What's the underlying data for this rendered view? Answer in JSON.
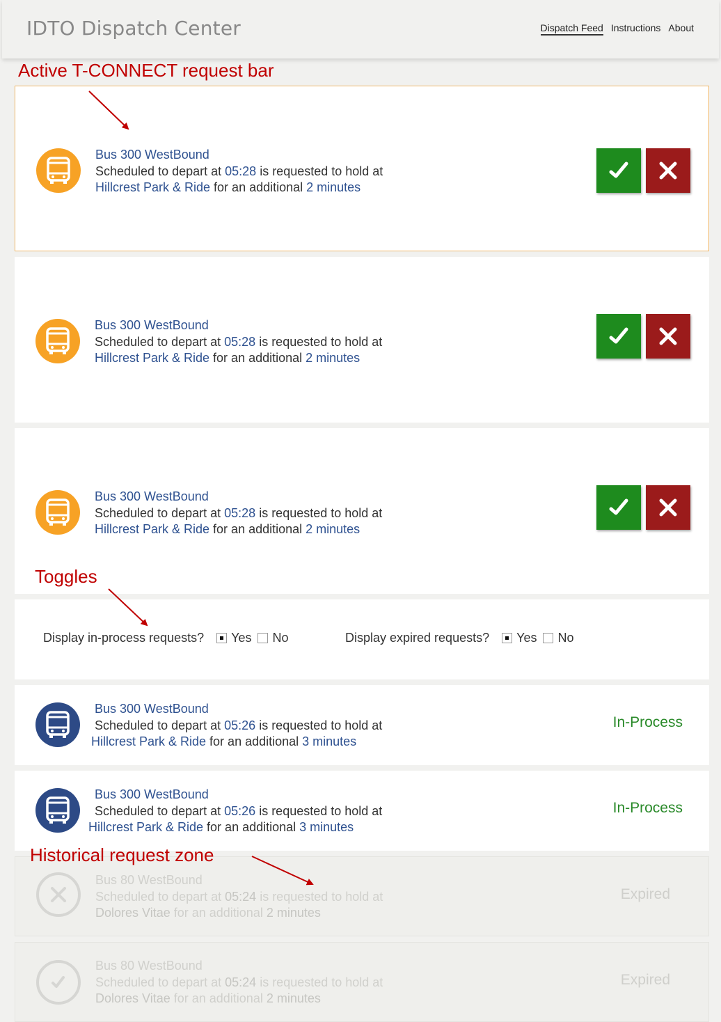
{
  "header": {
    "title": "IDTO Dispatch Center",
    "nav": [
      "Dispatch Feed",
      "Instructions",
      "About"
    ]
  },
  "annotations": {
    "active_bar": "Active T-CONNECT request bar",
    "toggles": "Toggles",
    "historical": "Historical request zone"
  },
  "active_requests": [
    {
      "bus": "Bus 300 WestBound",
      "pre": "Scheduled to depart at ",
      "time": "05:28",
      "mid": " is requested to hold at",
      "stop": "Hillcrest Park & Ride",
      "for": " for an additional ",
      "duration": "2 minutes"
    },
    {
      "bus": "Bus 300 WestBound",
      "pre": "Scheduled to depart at ",
      "time": "05:28",
      "mid": " is requested to hold at",
      "stop": "Hillcrest Park & Ride",
      "for": " for an additional ",
      "duration": "2 minutes"
    },
    {
      "bus": "Bus 300 WestBound",
      "pre": "Scheduled to depart at ",
      "time": "05:28",
      "mid": " is requested to hold at",
      "stop": "Hillcrest Park & Ride",
      "for": " for an additional ",
      "duration": "2 minutes"
    }
  ],
  "toggles": {
    "in_process": {
      "label": "Display in-process requests?",
      "yes": "Yes",
      "no": "No",
      "selected": "Yes"
    },
    "expired": {
      "label": "Display expired requests?",
      "yes": "Yes",
      "no": "No",
      "selected": "Yes"
    }
  },
  "in_process_requests": [
    {
      "bus": "Bus 300 WestBound",
      "pre": "Scheduled to depart at ",
      "time": "05:26",
      "mid": " is requested to hold at",
      "stop": "Hillcrest Park & Ride",
      "for": " for an additional ",
      "duration": "3 minutes",
      "status": "In-Process"
    },
    {
      "bus": "Bus 300 WestBound",
      "pre": "Scheduled to depart at ",
      "time": "05:26",
      "mid": " is requested to hold at",
      "stop": "Hillcrest Park & Ride",
      "for": " for an additional ",
      "duration": "3 minutes",
      "status": "In-Process"
    }
  ],
  "expired_requests": [
    {
      "bus": "Bus 80 WestBound",
      "pre": "Scheduled to depart at ",
      "time": "05:24",
      "mid": " is requested to hold at",
      "stop": "Dolores Vitae",
      "for": " for an additional ",
      "duration": "2 minutes",
      "status": "Expired",
      "icon": "x-circle-icon"
    },
    {
      "bus": "Bus 80 WestBound",
      "pre": "Scheduled to depart at ",
      "time": "05:24",
      "mid": " is requested to hold at",
      "stop": "Dolores Vitae",
      "for": " for an additional ",
      "duration": "2 minutes",
      "status": "Expired",
      "icon": "check-circle-icon"
    }
  ],
  "colors": {
    "accent_orange": "#f7a225",
    "bus_blue": "#2d4a86",
    "accept_green": "#1e8b1e",
    "reject_red": "#9b1b1b",
    "link_blue": "#2e5190",
    "annotation_red": "#c00000"
  }
}
